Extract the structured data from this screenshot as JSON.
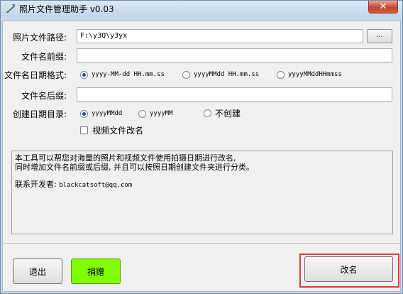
{
  "window": {
    "title": "照片文件管理助手 v0.03",
    "close_glyph": "✕"
  },
  "form": {
    "path_label": "照片文件路径:",
    "path_value": "F:\\y3Q\\y3yx",
    "browse_label": "...",
    "prefix_label": "文件名前缀:",
    "prefix_value": "",
    "date_format_label": "文件名日期格式:",
    "date_format_options": [
      "yyyy-MM-dd HH.mm.ss",
      "yyyyMMdd HH.mm.ss",
      "yyyyMMddHHmmss"
    ],
    "date_format_selected": 0,
    "suffix_label": "文件名后缀:",
    "suffix_value": "",
    "date_dir_label": "创建日期目录:",
    "date_dir_options": [
      "yyyyMMdd",
      "yyyyMM",
      "不创建"
    ],
    "date_dir_selected": 0,
    "video_rename_label": "视频文件改名",
    "video_rename_checked": false
  },
  "info": {
    "line1": "本工具可以帮您对海量的照片和视频文件使用拍摄日期进行改名,",
    "line2": "同时增加文件名前缀或后缀, 并且可以按照日期创建文件夹进行分类。",
    "contact_label": "联系开发者:",
    "contact_email": "blackcatsoft@qq.com"
  },
  "buttons": {
    "exit": "退出",
    "donate": "捐赠",
    "rename": "改名"
  },
  "colors": {
    "donate_bg": "#7fff00",
    "highlight": "#e53935",
    "close_bg": "#c7452f"
  }
}
